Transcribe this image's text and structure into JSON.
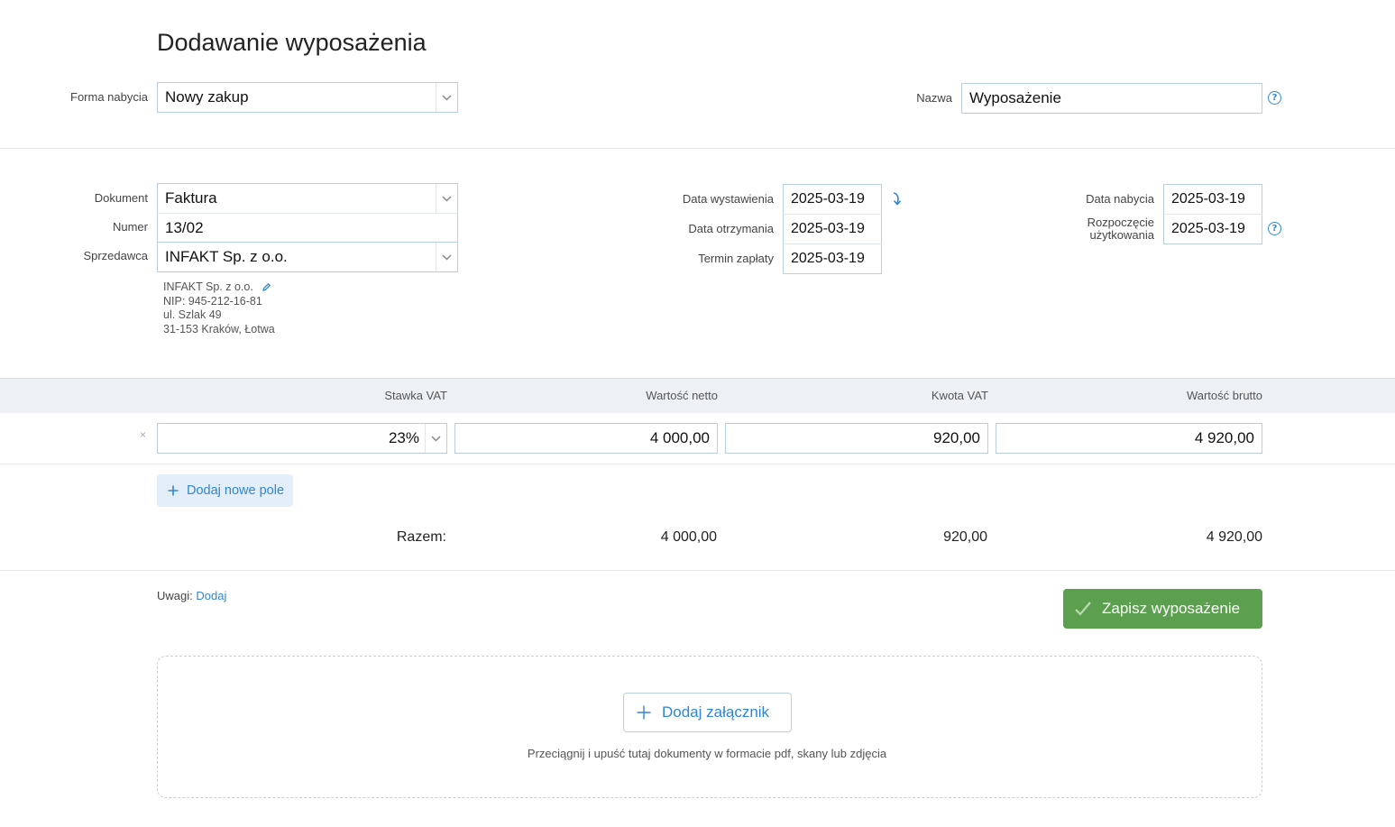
{
  "page": {
    "title": "Dodawanie wyposażenia"
  },
  "acquisition": {
    "form_label": "Forma nabycia",
    "form_value": "Nowy zakup",
    "name_label": "Nazwa",
    "name_value": "Wyposażenie",
    "help_glyph": "?"
  },
  "document": {
    "doc_label": "Dokument",
    "doc_value": "Faktura",
    "number_label": "Numer",
    "number_value": "13/02",
    "seller_label": "Sprzedawca",
    "seller_value": "INFAKT Sp. z o.o.",
    "seller_details": {
      "name": "INFAKT Sp. z o.o.",
      "nip": "NIP: 945-212-16-81",
      "street": "ul. Szlak 49",
      "city": "31-153 Kraków, Łotwa"
    }
  },
  "dates": {
    "issued_label": "Data wystawienia",
    "issued_value": "2025-03-19",
    "received_label": "Data otrzymania",
    "received_value": "2025-03-19",
    "due_label": "Termin zapłaty",
    "due_value": "2025-03-19",
    "acquired_label": "Data nabycia",
    "acquired_value": "2025-03-19",
    "usage_label_line1": "Rozpoczęcie",
    "usage_label_line2": "użytkowania",
    "usage_value": "2025-03-19"
  },
  "table": {
    "headers": {
      "vat_rate": "Stawka VAT",
      "net": "Wartość netto",
      "vat_amount": "Kwota VAT",
      "gross": "Wartość brutto"
    },
    "row": {
      "remove_glyph": "×",
      "vat_rate": "23%",
      "net": "4 000,00",
      "vat_amount": "920,00",
      "gross": "4 920,00"
    },
    "add_field_label": "Dodaj nowe pole",
    "totals": {
      "label": "Razem:",
      "net": "4 000,00",
      "vat_amount": "920,00",
      "gross": "4 920,00"
    }
  },
  "notes": {
    "label": "Uwagi:",
    "link": "Dodaj"
  },
  "actions": {
    "save_label": "Zapisz wyposażenie"
  },
  "attachments": {
    "add_label": "Dodaj załącznik",
    "hint": "Przeciągnij i upuść tutaj dokumenty w formacie pdf, skany lub zdjęcia"
  },
  "colors": {
    "accent": "#2f86d6",
    "save_green": "#5b9f4f",
    "table_header_bg": "#eef1f4"
  }
}
